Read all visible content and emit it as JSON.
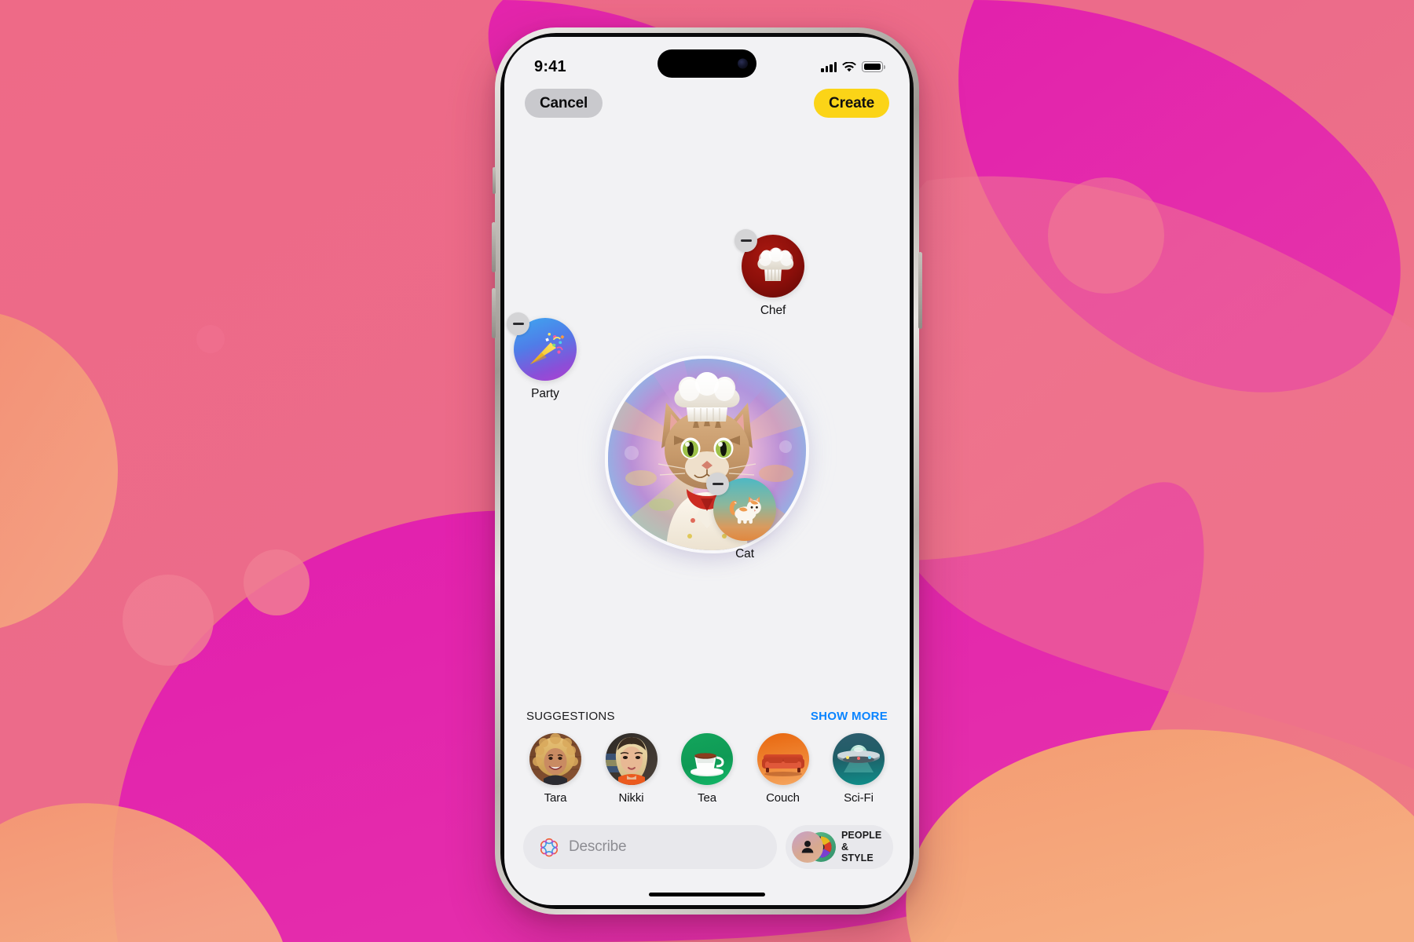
{
  "wallpaper": {
    "colors": {
      "base_pink": "#ec6b8a",
      "magenta": "#e323ab",
      "magenta_2": "#e52bb0",
      "salmon": "#f3996f",
      "peach": "#f5a878",
      "rose": "#ef7590",
      "dot": "#ef6f8d"
    }
  },
  "status_bar": {
    "time": "9:41",
    "signal_icon": "cellular-signal-icon",
    "wifi_icon": "wifi-icon",
    "battery_icon": "battery-icon"
  },
  "top_bar": {
    "cancel_label": "Cancel",
    "create_label": "Create",
    "create_color": "#fbd417",
    "cancel_color": "#c9c9cd"
  },
  "sticker": {
    "description": "Chef cat sticker",
    "alt": "Tabby cat wearing a white chef hat and chef coat"
  },
  "concepts": [
    {
      "id": "chef",
      "label": "Chef",
      "glyph": "👨‍🍳",
      "icon": "chef-hat-icon",
      "remove_icon": "minus-badge-icon"
    },
    {
      "id": "party",
      "label": "Party",
      "glyph": "🎉",
      "icon": "party-popper-icon",
      "remove_icon": "minus-badge-icon"
    },
    {
      "id": "cat",
      "label": "Cat",
      "glyph": "🐈",
      "icon": "cat-icon",
      "remove_icon": "minus-badge-icon"
    }
  ],
  "suggestions": {
    "title": "SUGGESTIONS",
    "show_more_label": "SHOW MORE",
    "show_more_color": "#0a84ff",
    "items": [
      {
        "id": "tara",
        "label": "Tara",
        "type": "photo"
      },
      {
        "id": "nikki",
        "label": "Nikki",
        "type": "photo"
      },
      {
        "id": "tea",
        "label": "Tea",
        "type": "emoji",
        "glyph": "☕"
      },
      {
        "id": "couch",
        "label": "Couch",
        "type": "emoji",
        "glyph": "🛋️"
      },
      {
        "id": "scifi",
        "label": "Sci-Fi",
        "type": "emoji",
        "glyph": "🛸"
      }
    ]
  },
  "bottom_bar": {
    "describe_placeholder": "Describe",
    "describe_value": "",
    "ai_icon": "apple-intelligence-icon",
    "people_style_line1": "PEOPLE",
    "people_style_line2": "& STYLE",
    "person_icon": "person-avatar-icon",
    "style_icon": "style-wheel-icon"
  }
}
